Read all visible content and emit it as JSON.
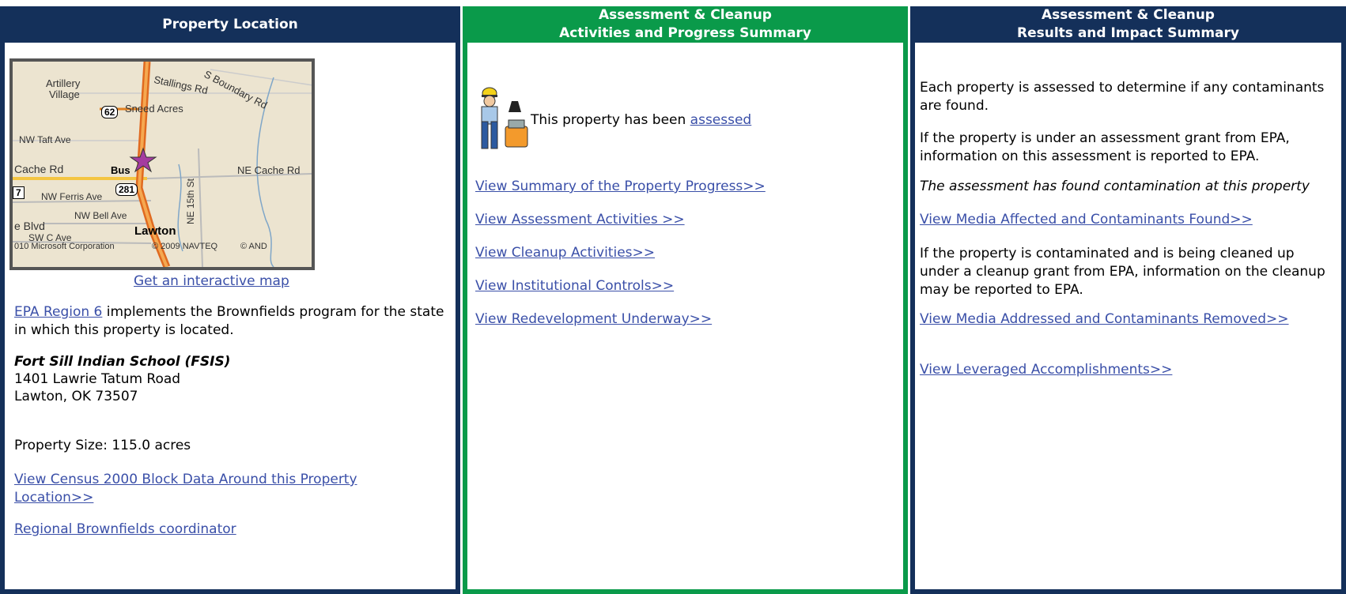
{
  "left": {
    "header": "Property Location",
    "map_link": "Get an interactive map",
    "region_link": "EPA Region 6",
    "region_text": " implements the Brownfields program for the state in which this property is located.",
    "property_name": "Fort Sill Indian School (FSIS)",
    "address1": "1401 Lawrie Tatum Road",
    "address2": "Lawton, OK 73507",
    "size": "Property Size: 115.0 acres",
    "census_link": "View Census 2000 Block Data Around this Property Location>>",
    "coordinator_link": "Regional Brownfields coordinator"
  },
  "map": {
    "labels": {
      "l1": "Artillery",
      "l2": "Village",
      "l3": "Stallings Rd",
      "l4": "S Boundary Rd",
      "l5": "Sneed Acres",
      "l6": "NW Taft Ave",
      "l7": "Cache Rd",
      "l8": "Bus",
      "l9": "NE Cache Rd",
      "l10": "NW Ferris Ave",
      "l11": "NW Bell Ave",
      "l12": "NE 15th St",
      "l13": "e Blvd",
      "l14": "SW C Ave",
      "l15": "Lawton",
      "l16": "010 Microsoft Corporation",
      "l17": "© 2009 NAVTEQ",
      "l18": "© AND",
      "shield62": "62",
      "shield281": "281",
      "shield7": "7"
    }
  },
  "middle": {
    "header1": "Assessment & Cleanup",
    "header2": "Activities and Progress Summary",
    "status_text": "This property has been ",
    "status_link": "assessed",
    "links": [
      "View Summary of the Property Progress>>",
      "View Assessment Activities >>",
      "View Cleanup Activities>>",
      "View Institutional Controls>>",
      "View Redevelopment Underway>>"
    ]
  },
  "right": {
    "header1": "Assessment & Cleanup",
    "header2": "Results and Impact Summary",
    "p1": "Each property is assessed to determine if any contaminants are found.",
    "p2": "If the property is under an assessment grant from EPA, information on this assessment is reported to EPA.",
    "p3": "The assessment has found contamination at this property",
    "link1": "View Media Affected and Contaminants Found>>",
    "p4": "If the property is contaminated and is being cleaned up under a cleanup grant from EPA, information on the cleanup may be reported to EPA.",
    "link2": "View Media Addressed and Contaminants Removed>>",
    "link3": "View Leveraged Accomplishments>>"
  },
  "colors": {
    "navy": "#14305a",
    "green": "#0a9a4a",
    "link": "#3a4fa8"
  }
}
